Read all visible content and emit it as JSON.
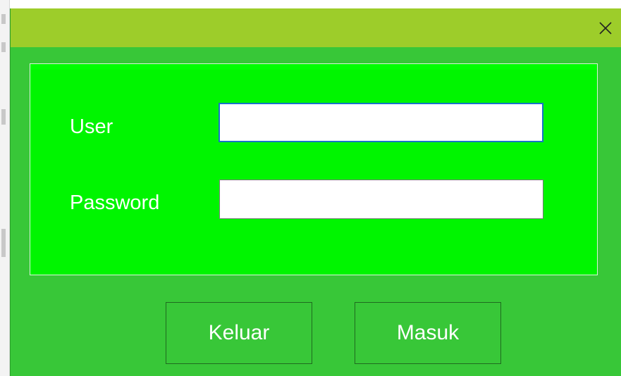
{
  "window": {
    "close_icon": "close-icon",
    "title_bar_color": "#9dcd2a",
    "background_color": "#38c738",
    "panel_color": "#00f500"
  },
  "form": {
    "user_label": "User",
    "user_value": "",
    "password_label": "Password",
    "password_value": ""
  },
  "buttons": {
    "exit_label": "Keluar",
    "login_label": "Masuk"
  }
}
